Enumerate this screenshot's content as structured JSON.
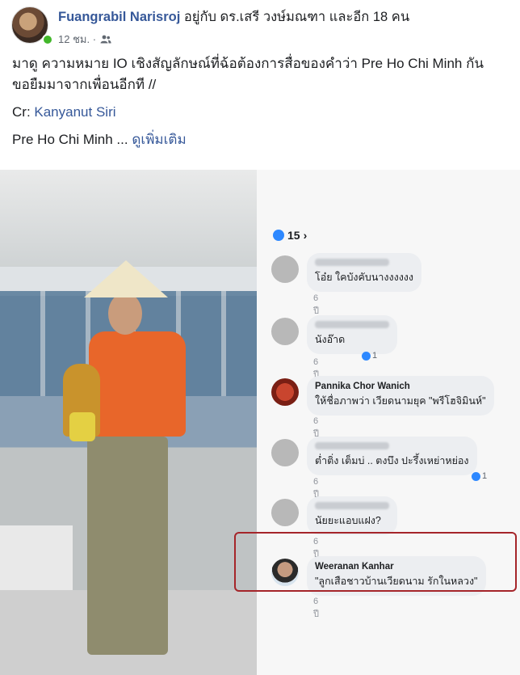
{
  "post": {
    "author": "Fuangrabil Narisroj",
    "with_text": "อยู่กับ ดร.เสรี วงษ์มณฑา และอีก 18 คน",
    "time": "12 ชม. ·",
    "audience_icon": "friends-icon",
    "paragraph1": "มาดู ความหมาย IO เชิงสัญลักษณ์ที่ฉ้อต้องการสื่อของคำว่า Pre Ho Chi Minh กัน ขอยืมมาจากเพื่อนอีกที //",
    "credit_prefix": "Cr: ",
    "credit_name": "Kanyanut Siri",
    "paragraph3": "Pre Ho Chi Minh ...",
    "see_more": "ดูเพิ่มเติม"
  },
  "photo": {
    "likes_count": "15",
    "likes_chevron": "›",
    "comments": [
      {
        "name": "",
        "text": "โอ๋ย ใคบังคับนางงงงงง",
        "age": "6 ปี"
      },
      {
        "name": "",
        "text": "นังอ๊าด",
        "age": "6 ปี",
        "reactions": "1"
      },
      {
        "name": "Pannika Chor Wanich",
        "text": "ให้ชื่อภาพว่า เวียดนามยุค \"พรีโฮจิมินห์\"",
        "age": "6 ปี"
      },
      {
        "name": "",
        "text": "ต่ำติ่ง เต็มบ่ .. ตงบึง ปะรึ้งเหย่าหย่อง",
        "age": "6 ปี",
        "reactions": "1"
      },
      {
        "name": "",
        "text": "นัยยะแอบแฝง?",
        "age": "6 ปี"
      },
      {
        "name": "Weeranan Kanhar",
        "text": "\"ลูกเสือชาวบ้านเวียดนาม รักในหลวง\"",
        "age": "6 ปี"
      }
    ]
  },
  "colors": {
    "link": "#365899",
    "highlight": "#a5252a",
    "online": "#42b72a"
  }
}
